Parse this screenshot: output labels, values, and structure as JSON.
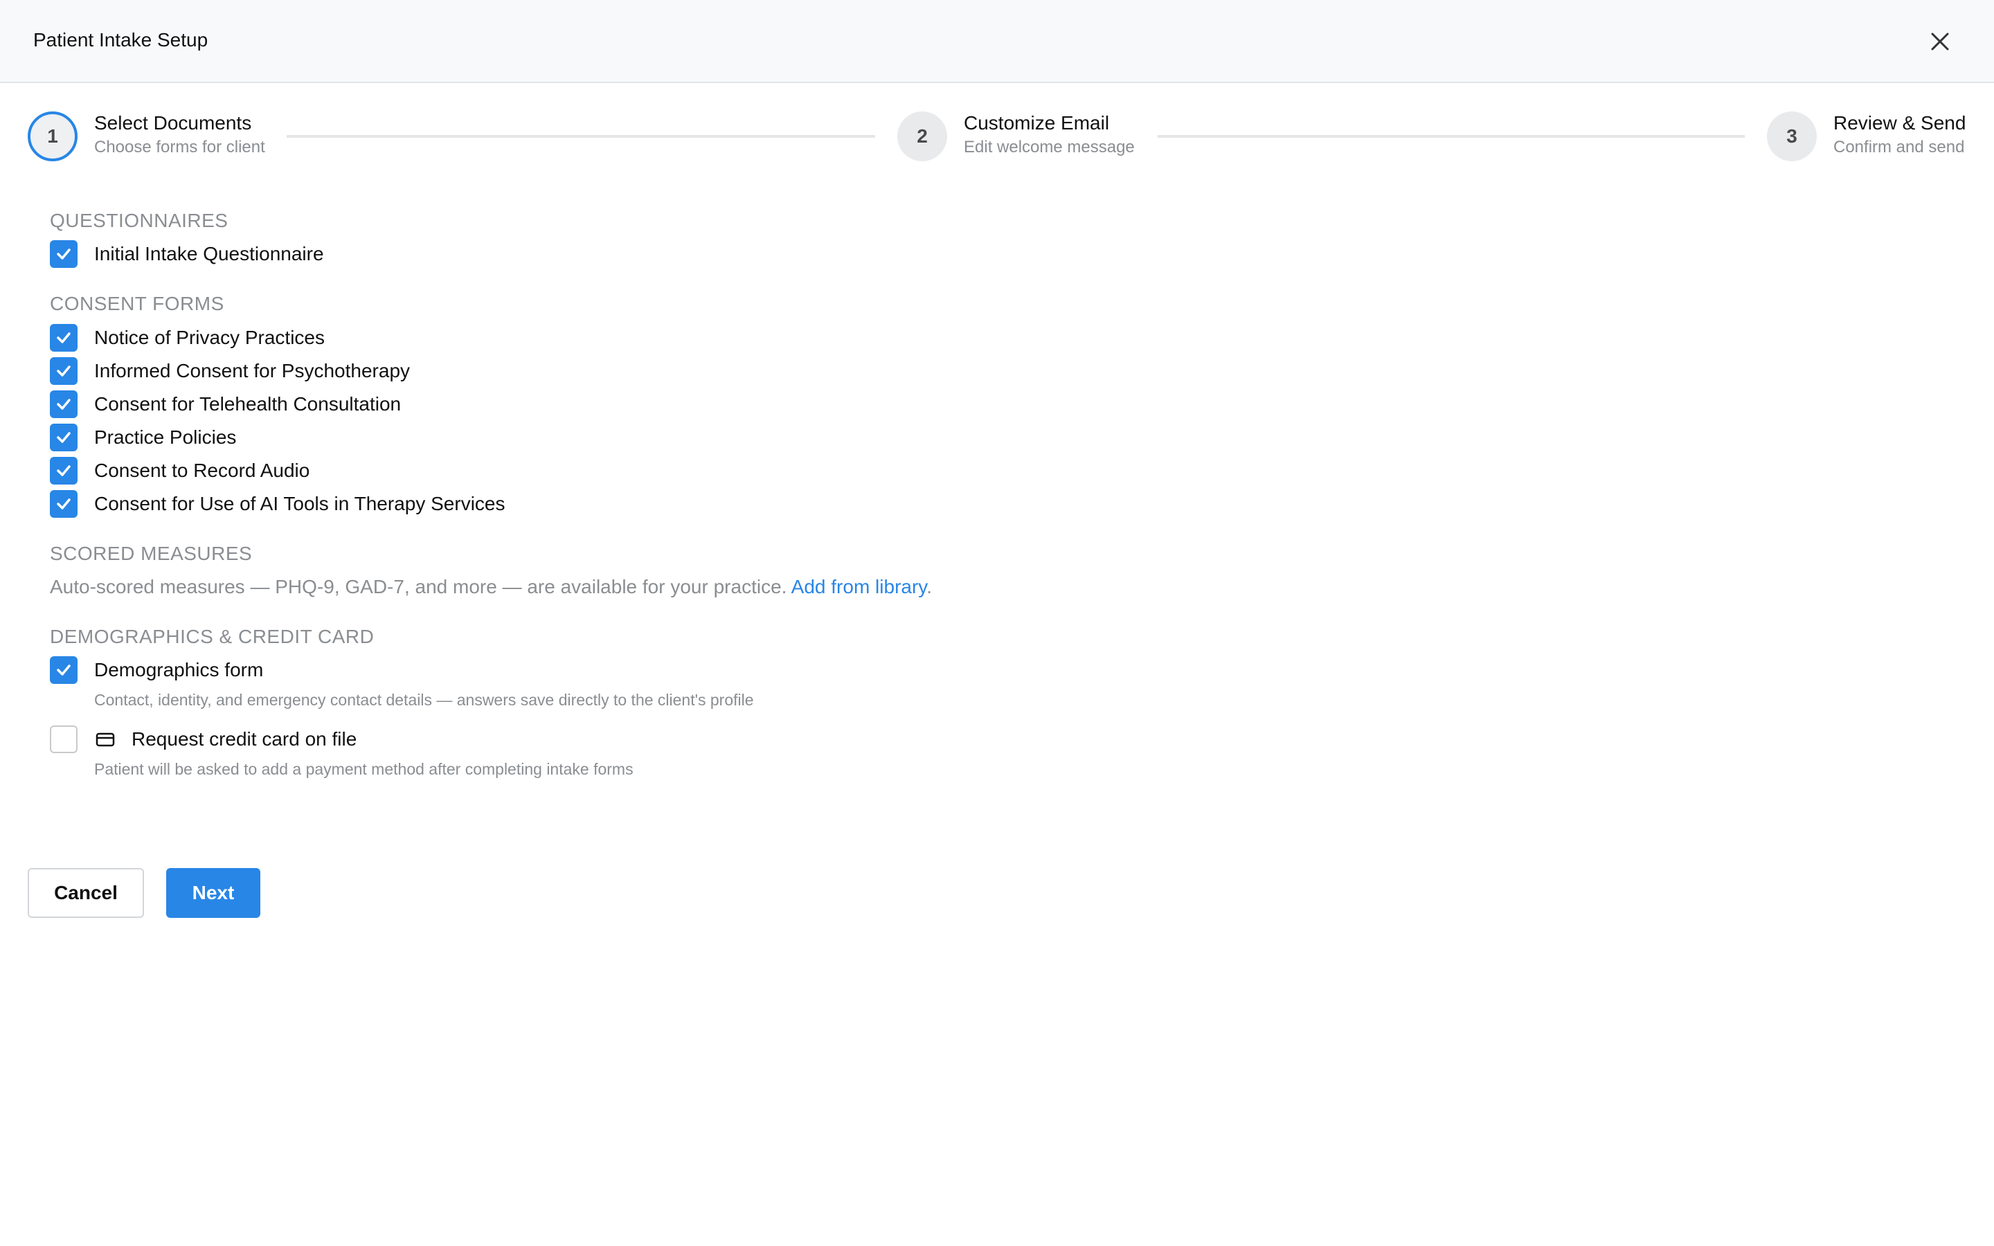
{
  "dialog": {
    "title": "Patient Intake Setup",
    "close_icon": "close-icon"
  },
  "stepper": {
    "active_step": 1,
    "steps": [
      {
        "number": "1",
        "title": "Select Documents",
        "subtitle": "Choose forms for client"
      },
      {
        "number": "2",
        "title": "Customize Email",
        "subtitle": "Edit welcome message"
      },
      {
        "number": "3",
        "title": "Review & Send",
        "subtitle": "Confirm and send"
      }
    ]
  },
  "sections": {
    "questionnaires": {
      "heading": "QUESTIONNAIRES",
      "items": [
        {
          "label": "Initial Intake Questionnaire",
          "checked": true
        }
      ]
    },
    "consent_forms": {
      "heading": "CONSENT FORMS",
      "items": [
        {
          "label": "Notice of Privacy Practices",
          "checked": true
        },
        {
          "label": "Informed Consent for Psychotherapy",
          "checked": true
        },
        {
          "label": "Consent for Telehealth Consultation",
          "checked": true
        },
        {
          "label": "Practice Policies",
          "checked": true
        },
        {
          "label": "Consent to Record Audio",
          "checked": true
        },
        {
          "label": "Consent for Use of AI Tools in Therapy Services",
          "checked": true
        }
      ]
    },
    "scored_measures": {
      "heading": "SCORED MEASURES",
      "text": "Auto-scored measures — PHQ-9, GAD-7, and more — are available for your practice. ",
      "link_text": "Add from library",
      "trailing": "."
    },
    "demographics": {
      "heading": "DEMOGRAPHICS & CREDIT CARD",
      "demographics_form": {
        "label": "Demographics form",
        "checked": true,
        "helper": "Contact, identity, and emergency contact details — answers save directly to the client's profile"
      },
      "credit_card": {
        "label": "Request credit card on file",
        "checked": false,
        "icon": "credit-card-icon",
        "helper": "Patient will be asked to add a payment method after completing intake forms"
      }
    }
  },
  "footer": {
    "cancel_label": "Cancel",
    "next_label": "Next"
  },
  "colors": {
    "accent": "#2886e6",
    "muted_text": "#8a8d91",
    "header_bg": "#f8f9fb"
  }
}
